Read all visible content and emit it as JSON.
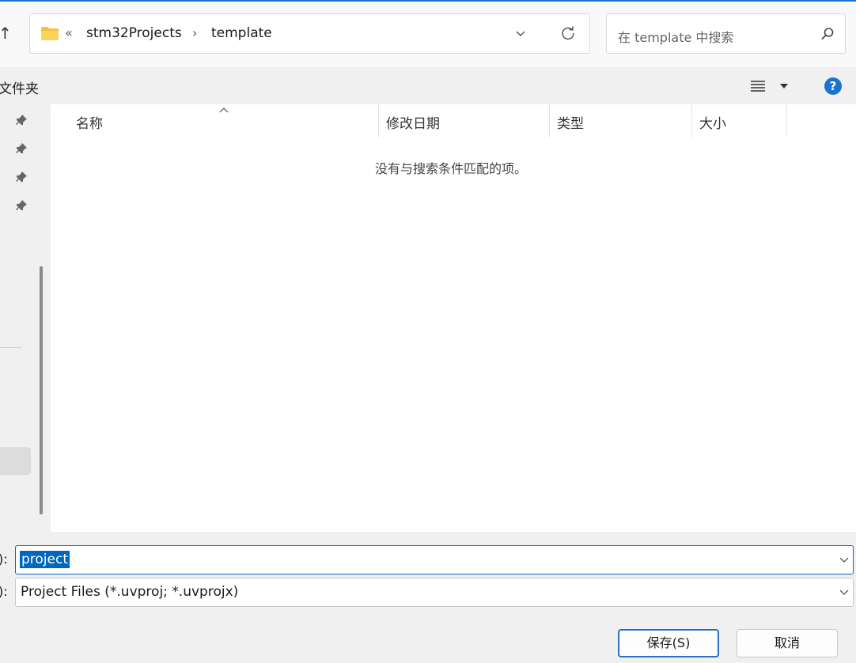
{
  "address_bar": {
    "overflow_chevron": "«",
    "breadcrumbs": [
      "stm32Projects",
      "template"
    ],
    "separator": "›"
  },
  "search": {
    "placeholder": "在 template 中搜索"
  },
  "command_bar": {
    "new_folder_label_partial": "文件夹"
  },
  "columns": [
    "名称",
    "修改日期",
    "类型",
    "大小"
  ],
  "empty_message": "没有与搜索条件匹配的项。",
  "file_name": {
    "label_partial": "):",
    "value": "project"
  },
  "file_type": {
    "label_partial": "):",
    "value": "Project Files (*.uvproj; *.uvprojx)"
  },
  "buttons": {
    "save": "保存(S)",
    "cancel": "取消"
  },
  "colors": {
    "accent": "#0067c0",
    "help_blue": "#1a73d1",
    "folder_yellow": "#f4c13f"
  },
  "icons": [
    "up-arrow-icon",
    "folder-icon",
    "chevron-down-icon",
    "refresh-icon",
    "search-icon",
    "view-list-icon",
    "help-icon",
    "pin-icon",
    "sort-up-icon"
  ]
}
